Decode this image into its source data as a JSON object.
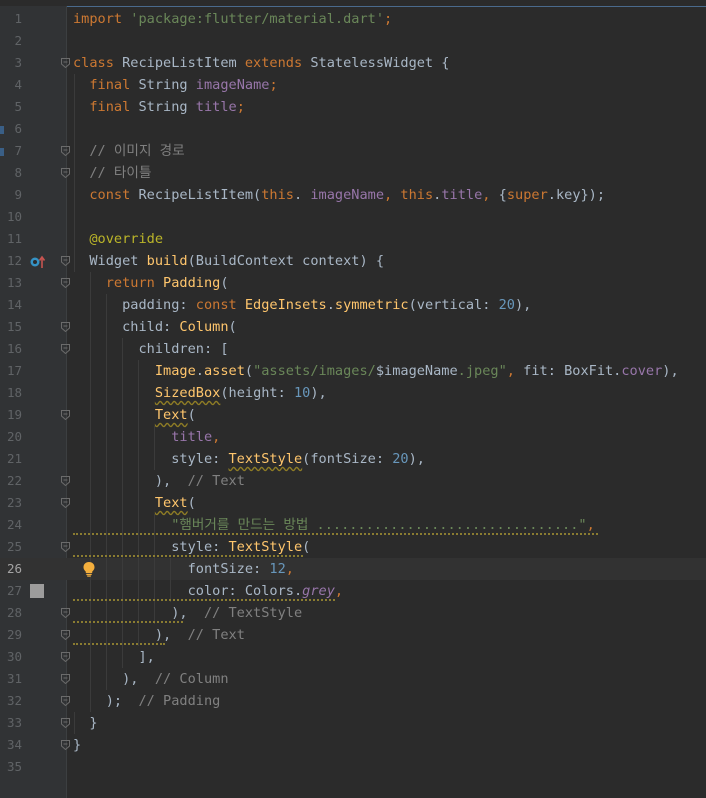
{
  "editor": {
    "current_line": 26,
    "lines": [
      {
        "n": "1",
        "tokens": [
          [
            "kw",
            "import "
          ],
          [
            "str",
            "'package:flutter/material.dart'"
          ],
          [
            "kw",
            ";"
          ]
        ]
      },
      {
        "n": "2",
        "tokens": []
      },
      {
        "n": "3",
        "fold": true,
        "tokens": [
          [
            "kw",
            "class "
          ],
          [
            "",
            "RecipeListItem "
          ],
          [
            "kw",
            "extends "
          ],
          [
            "",
            "StatelessWidget {"
          ]
        ]
      },
      {
        "n": "4",
        "tokens": [
          [
            "",
            "  "
          ],
          [
            "kw",
            "final "
          ],
          [
            "",
            "String "
          ],
          [
            "fld",
            "imageName"
          ],
          [
            "kw",
            ";"
          ]
        ]
      },
      {
        "n": "5",
        "tokens": [
          [
            "",
            "  "
          ],
          [
            "kw",
            "final "
          ],
          [
            "",
            "String "
          ],
          [
            "fld",
            "title"
          ],
          [
            "kw",
            ";"
          ]
        ]
      },
      {
        "n": "6",
        "tokens": []
      },
      {
        "n": "7",
        "fold": true,
        "tokens": [
          [
            "",
            "  "
          ],
          [
            "cm",
            "// 이미지 경로"
          ]
        ]
      },
      {
        "n": "8",
        "fold": true,
        "tokens": [
          [
            "",
            "  "
          ],
          [
            "cm",
            "// 타이틀"
          ]
        ]
      },
      {
        "n": "9",
        "tokens": [
          [
            "",
            "  "
          ],
          [
            "kw",
            "const "
          ],
          [
            "",
            "RecipeListItem("
          ],
          [
            "kw",
            "this"
          ],
          [
            "",
            ". "
          ],
          [
            "fld",
            "imageName"
          ],
          [
            "kw",
            ", "
          ],
          [
            "kw",
            "this"
          ],
          [
            "",
            "."
          ],
          [
            "fld",
            "title"
          ],
          [
            "kw",
            ", "
          ],
          [
            "",
            "{"
          ],
          [
            "kw",
            "super"
          ],
          [
            "",
            ".key});"
          ]
        ]
      },
      {
        "n": "10",
        "tokens": []
      },
      {
        "n": "11",
        "tokens": [
          [
            "",
            "  "
          ],
          [
            "ann",
            "@override"
          ]
        ]
      },
      {
        "n": "12",
        "fold": true,
        "override": true,
        "tokens": [
          [
            "",
            "  Widget "
          ],
          [
            "cls",
            "build"
          ],
          [
            "",
            "(BuildContext context) {"
          ]
        ]
      },
      {
        "n": "13",
        "fold": true,
        "tokens": [
          [
            "",
            "    "
          ],
          [
            "kw",
            "return "
          ],
          [
            "cls",
            "Padding"
          ],
          [
            "",
            "("
          ]
        ]
      },
      {
        "n": "14",
        "tokens": [
          [
            "",
            "      padding: "
          ],
          [
            "kw",
            "const "
          ],
          [
            "cls",
            "EdgeInsets"
          ],
          [
            "",
            "."
          ],
          [
            "cls",
            "symmetric"
          ],
          [
            "",
            "(vertical: "
          ],
          [
            "num",
            "20"
          ],
          [
            "",
            "),"
          ]
        ]
      },
      {
        "n": "15",
        "fold": true,
        "tokens": [
          [
            "",
            "      child: "
          ],
          [
            "cls",
            "Column"
          ],
          [
            "",
            "("
          ]
        ]
      },
      {
        "n": "16",
        "fold": true,
        "tokens": [
          [
            "",
            "        children: ["
          ]
        ]
      },
      {
        "n": "17",
        "tokens": [
          [
            "",
            "          "
          ],
          [
            "cls",
            "Image"
          ],
          [
            "",
            "."
          ],
          [
            "cls",
            "asset"
          ],
          [
            "",
            "("
          ],
          [
            "str",
            "\"assets/images/"
          ],
          [
            "",
            "$imageName"
          ],
          [
            "str",
            ".jpeg\""
          ],
          [
            "kw",
            ", "
          ],
          [
            "",
            "fit: BoxFit."
          ],
          [
            "fld",
            "cover"
          ],
          [
            "",
            "),"
          ]
        ]
      },
      {
        "n": "18",
        "tokens": [
          [
            "",
            "          "
          ],
          [
            "cls warn",
            "SizedBox"
          ],
          [
            "",
            "(height: "
          ],
          [
            "num",
            "10"
          ],
          [
            "",
            "),"
          ]
        ]
      },
      {
        "n": "19",
        "fold": true,
        "tokens": [
          [
            "",
            "          "
          ],
          [
            "cls warn",
            "Text"
          ],
          [
            "",
            "("
          ]
        ]
      },
      {
        "n": "20",
        "tokens": [
          [
            "",
            "            "
          ],
          [
            "fld",
            "title"
          ],
          [
            "kw",
            ","
          ]
        ]
      },
      {
        "n": "21",
        "tokens": [
          [
            "",
            "            style: "
          ],
          [
            "cls warn",
            "TextStyle"
          ],
          [
            "",
            "(fontSize: "
          ],
          [
            "num",
            "20"
          ],
          [
            "",
            "),"
          ]
        ]
      },
      {
        "n": "22",
        "fold": true,
        "tokens": [
          [
            "",
            "          ), "
          ],
          [
            "cm",
            " // Text"
          ]
        ]
      },
      {
        "n": "23",
        "fold": true,
        "tokens": [
          [
            "",
            "          "
          ],
          [
            "cls warn",
            "Text"
          ],
          [
            "",
            "("
          ]
        ]
      },
      {
        "n": "24",
        "squiggle": true,
        "tokens": [
          [
            "",
            "            "
          ],
          [
            "str",
            "\"햄버거를 만드는 방법 ................................\""
          ],
          [
            "kw",
            ","
          ]
        ]
      },
      {
        "n": "25",
        "fold": true,
        "squiggle": true,
        "tokens": [
          [
            "",
            "            style: "
          ],
          [
            "cls",
            "TextStyle"
          ],
          [
            "",
            "("
          ]
        ]
      },
      {
        "n": "26",
        "bulb": true,
        "tokens": [
          [
            "",
            "              fontSize: "
          ],
          [
            "num",
            "12"
          ],
          [
            "kw",
            ","
          ]
        ]
      },
      {
        "n": "27",
        "breakpoint": true,
        "squiggle": true,
        "tokens": [
          [
            "",
            "              color: Colors."
          ],
          [
            "fld it",
            "grey"
          ],
          [
            "kw",
            ","
          ]
        ]
      },
      {
        "n": "28",
        "fold": true,
        "squiggle": true,
        "tokens": [
          [
            "",
            "            ),"
          ],
          [
            "cm",
            "  // TextStyle"
          ]
        ]
      },
      {
        "n": "29",
        "fold": true,
        "squiggle": true,
        "tokens": [
          [
            "",
            "          ),"
          ],
          [
            "cm",
            "  // Text"
          ]
        ]
      },
      {
        "n": "30",
        "fold": true,
        "tokens": [
          [
            "",
            "        ],"
          ]
        ]
      },
      {
        "n": "31",
        "fold": true,
        "tokens": [
          [
            "",
            "      ),"
          ],
          [
            "cm",
            "  // Column"
          ]
        ]
      },
      {
        "n": "32",
        "fold": true,
        "tokens": [
          [
            "",
            "    );"
          ],
          [
            "cm",
            "  // Padding"
          ]
        ]
      },
      {
        "n": "33",
        "fold": true,
        "tokens": [
          [
            "",
            "  }"
          ]
        ]
      },
      {
        "n": "34",
        "fold": true,
        "tokens": [
          [
            "",
            "}"
          ]
        ]
      },
      {
        "n": "35",
        "tokens": []
      }
    ]
  },
  "colors": {
    "background": "#2b2b2b",
    "gutter": "#313335",
    "keyword": "#cc7832",
    "string": "#6a8759",
    "comment": "#808080",
    "number": "#6897bb",
    "field": "#9876aa",
    "function": "#ffc66d",
    "annotation": "#bbb529",
    "text": "#a9b7c6"
  },
  "icons": {
    "bulb": "lightbulb-icon",
    "override": "override-method-icon",
    "breakpoint": "breakpoint-icon",
    "fold": "fold-marker-icon"
  }
}
